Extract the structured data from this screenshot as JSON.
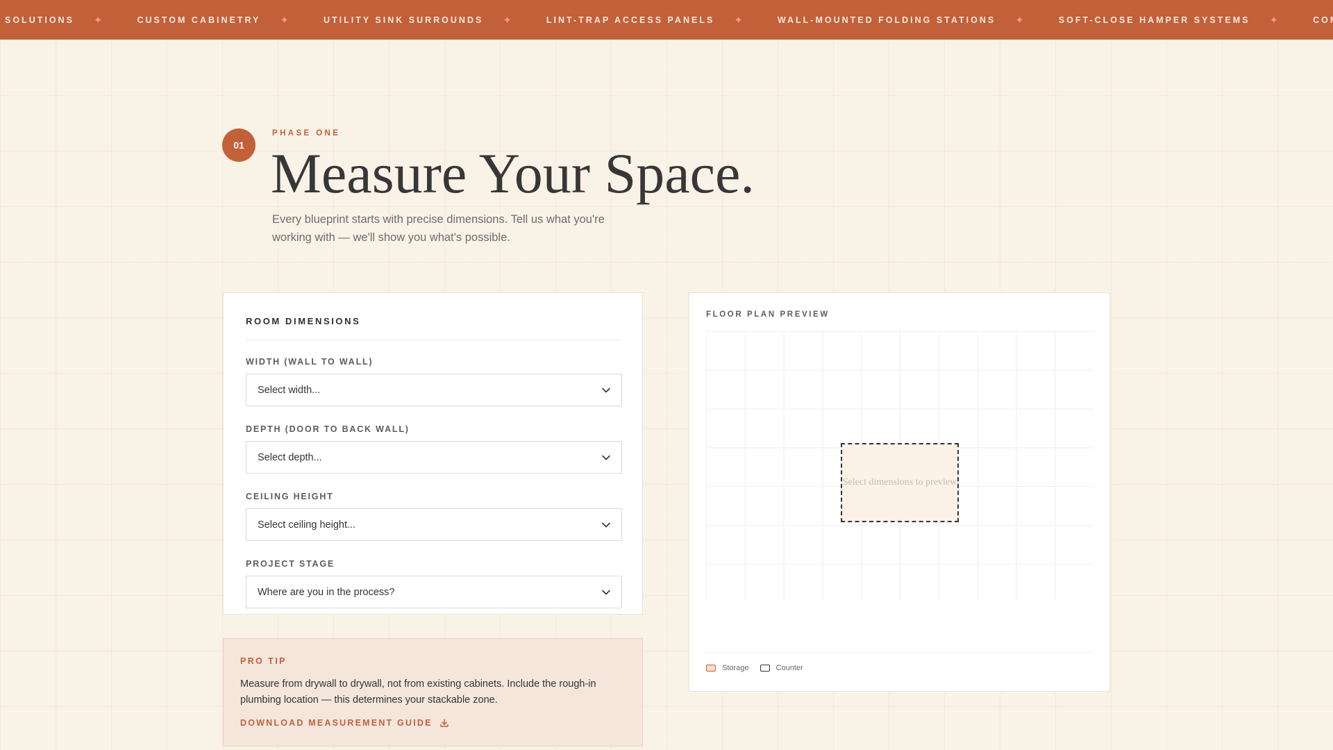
{
  "ticker": {
    "items": [
      "SOLUTIONS",
      "CUSTOM CABINETRY",
      "UTILITY SINK SURROUNDS",
      "LINT-TRAP ACCESS PANELS",
      "WALL-MOUNTED FOLDING STATIONS",
      "SOFT-CLOSE HAMPER SYSTEMS",
      "COMMERCIAL-G"
    ],
    "separator": "✦"
  },
  "phase": {
    "number": "01",
    "eyebrow": "PHASE ONE",
    "title": "Measure Your Space.",
    "subtitle": "Every blueprint starts with precise dimensions. Tell us what you're working with — we'll show you what's possible."
  },
  "dimensions": {
    "title": "ROOM DIMENSIONS",
    "fields": [
      {
        "label": "WIDTH (WALL TO WALL)",
        "value": "Select width..."
      },
      {
        "label": "DEPTH (DOOR TO BACK WALL)",
        "value": "Select depth..."
      },
      {
        "label": "CEILING HEIGHT",
        "value": "Select ceiling height..."
      },
      {
        "label": "PROJECT STAGE",
        "value": "Where are you in the process?"
      }
    ]
  },
  "tip": {
    "title": "PRO TIP",
    "text": "Measure from drywall to drywall, not from existing cabinets. Include the rough-in plumbing location — this determines your stackable zone.",
    "link": "DOWNLOAD MEASUREMENT GUIDE"
  },
  "floor_plan": {
    "title": "FLOOR PLAN PREVIEW",
    "placeholder": "Select dimensions to preview",
    "legend": [
      {
        "label": "Storage"
      },
      {
        "label": "Counter"
      }
    ]
  },
  "colors": {
    "accent": "#c2603a",
    "background": "#f9f2e6",
    "tip_background": "#f5e6dc",
    "text_dark": "#373737"
  }
}
